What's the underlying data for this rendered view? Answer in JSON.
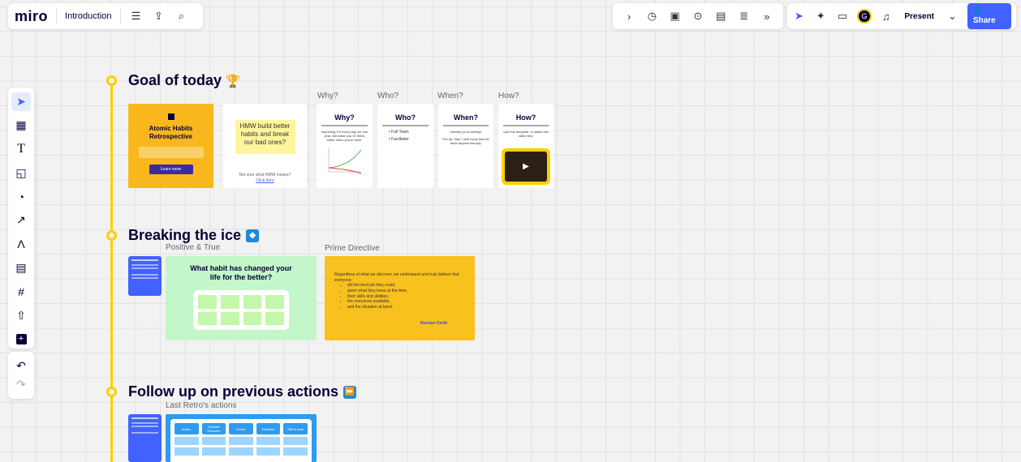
{
  "app": {
    "logo": "miro",
    "board_name": "Introduction"
  },
  "toolbar": {
    "present_label": "Present",
    "share_label": "Share",
    "avatar_initial": "G"
  },
  "sections": {
    "goal": {
      "title": "Goal of today",
      "emoji": "trophy"
    },
    "ice": {
      "title": "Breaking the ice",
      "emoji": "ice-cube"
    },
    "followup": {
      "title": "Follow up on previous actions",
      "emoji": "fast-forward"
    }
  },
  "goal_cards": {
    "atomic": {
      "title": "Atomic Habits Retrospective",
      "btn": "Learn more"
    },
    "hmw": {
      "sticky": "HMW build better habits and break our bad ones?",
      "note": "Not sure what HMW means?",
      "link": "Click here"
    },
    "why": {
      "frame_label": "Why?",
      "title": "Why?",
      "body": "Improving 1% every day, for one year, will make you 37 times better when you're done."
    },
    "who": {
      "frame_label": "Who?",
      "title": "Who?",
      "item1": "Full Team",
      "item2": "Facilitator"
    },
    "when": {
      "frame_label": "When?",
      "title": "When?",
      "body": "Weekly (or bi-weekly)",
      "tip": "Pro tip: Stop ! until it just also be done asynchronously."
    },
    "how": {
      "frame_label": "How?",
      "title": "How?",
      "body": "Use this template, or watch this video first."
    }
  },
  "ice_cards": {
    "positive": {
      "frame_label": "Positive & True",
      "title": "What habit has changed your life for the better?"
    },
    "prime": {
      "frame_label": "Prime Directive",
      "intro": "Regardless of what we discover, we understand and truly believe that everyone:",
      "items": [
        "did the best job they could,",
        "given what they knew at the time,",
        "their skills and abilities,",
        "the resources available,",
        "and the situation at hand."
      ],
      "author": "Norman Kerth"
    }
  },
  "followup_cards": {
    "last": {
      "frame_label": "Last Retro's actions",
      "headers": [
        "Action",
        "Desired Outcome",
        "Owner",
        "Deadline",
        "Still to work"
      ]
    }
  },
  "colors": {
    "yellow": "#fcd000",
    "miro_blue": "#4262ff",
    "green": "#c3f7c9",
    "card_yellow": "#f9c11d"
  }
}
